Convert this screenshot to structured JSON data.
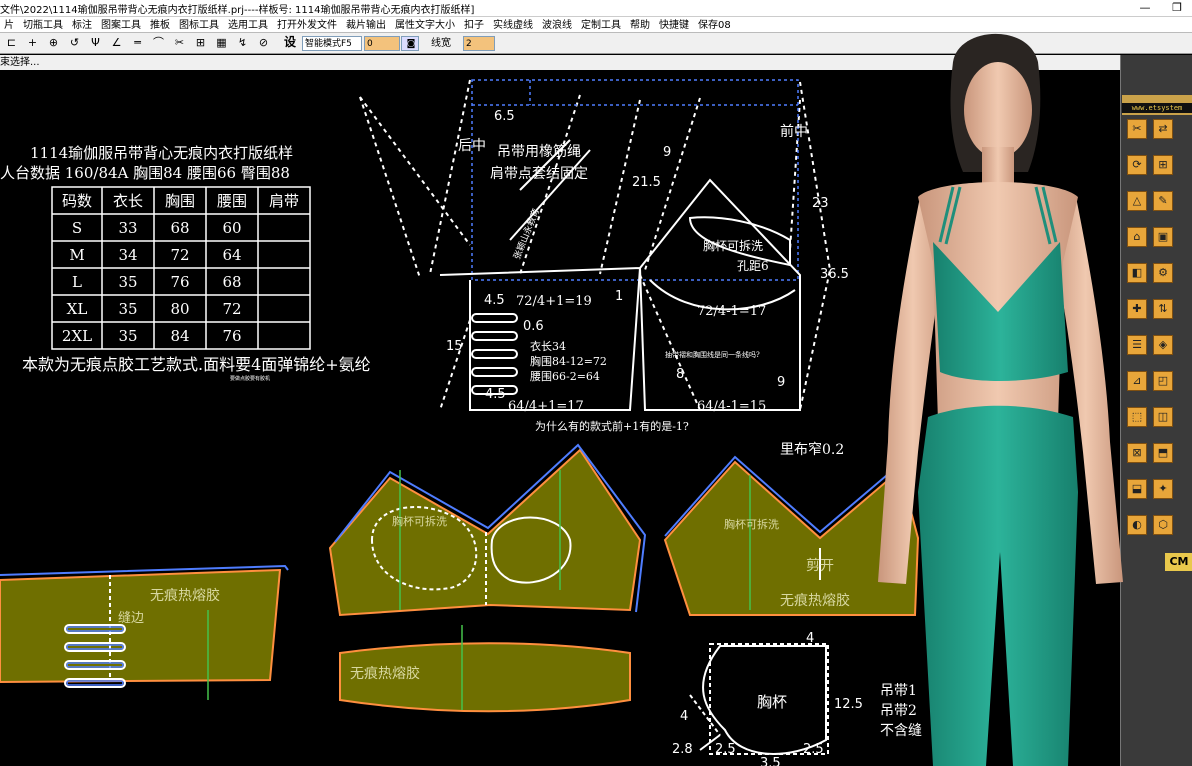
{
  "window": {
    "title": "文件\\2022\\1114瑜伽服吊带背心无痕内衣打版纸样.prj----样板号: 1114瑜伽服吊带背心无痕内衣打版纸样]",
    "restore_glyph": "❐"
  },
  "menubar": {
    "items": [
      "片",
      "切瓶工具",
      "标注",
      "图案工具",
      "推板",
      "图标工具",
      "选用工具",
      "打开外发文件",
      "裁片输出",
      "属性文字大小",
      "扣子",
      "实线虚线",
      "波浪线",
      "定制工具",
      "帮助",
      "快捷键",
      "保存08"
    ]
  },
  "toolbar": {
    "icons": [
      "⊏",
      "+",
      "⊕",
      "↺",
      "Ψ",
      "∠",
      "═",
      "⌒",
      "✂",
      "⊞",
      "▦",
      "↯",
      "⊘"
    ],
    "set_label": "设",
    "mode_select": "智能模式F5",
    "value_field": "0",
    "line_width_label": "线宽",
    "line_width_value": "2"
  },
  "status": {
    "text": "束选择..."
  },
  "right_panel": {
    "url": "www.etsystem",
    "brand": "CM"
  },
  "drawing": {
    "table_title": "1114瑜伽服吊带背心无痕内衣打版纸样",
    "body_data": "人台数据 160/84A  胸围84  腰围66  臀围88",
    "table_headers": [
      "码数",
      "衣长",
      "胸围",
      "腰围",
      "肩带"
    ],
    "table_rows": [
      [
        "S",
        "33",
        "68",
        "60",
        ""
      ],
      [
        "M",
        "34",
        "72",
        "64",
        ""
      ],
      [
        "L",
        "35",
        "76",
        "68",
        ""
      ],
      [
        "XL",
        "35",
        "80",
        "72",
        ""
      ],
      [
        "2XL",
        "35",
        "84",
        "76",
        ""
      ]
    ],
    "note_main": "本款为无痕点胶工艺款式.面料要4面弹锦纶+氨纶",
    "note_tiny": "要做点胶要有胶机",
    "back_center": "后中",
    "strap_note1": "吊带用橡筋绳",
    "strap_note2": "肩带点套结固定",
    "front_center": "前中",
    "cup_remove": "胸杯可拆洗",
    "hole_distance": "孔距6",
    "slant_text": "张颖山永教育",
    "spec_length": "衣长34",
    "spec_bust": "胸围84-12=72",
    "spec_waist": "腰围66-2=64",
    "formula_back_top": "72/4+1=19",
    "formula_front_top": "72/4-1=17",
    "formula_back_bottom": "64/4+1=17",
    "formula_front_bottom": "64/4-1=15",
    "question_small": "抽带褶和胸围线是同一条线吗?",
    "question_bottom": "为什么有的款式前+1有的是-1?",
    "lining_note": "里布窄0.2",
    "seamless_glue": "无痕热熔胶",
    "cup_opening": "胸杯可拆洗",
    "cut_open": "剪开",
    "cup_label": "胸杯",
    "strap_note_a": "吊带1",
    "strap_note_b": "吊带2",
    "strap_note_c": "不含缝",
    "binding": "缝边",
    "dims": {
      "d65": "6.5",
      "d9": "9",
      "d215": "21.5",
      "d23": "23",
      "d365": "36.5",
      "d45a": "4.5",
      "d06": "0.6",
      "d15": "15",
      "d45b": "4.5",
      "d1": "1",
      "d8": "8",
      "d9b": "9",
      "d4a": "4",
      "d4b": "4",
      "d125": "12.5",
      "d28": "2.8",
      "d25a": "2.5",
      "d25b": "2.5",
      "d35": "3.5",
      "d02": "0.2"
    }
  },
  "colors": {
    "canvas_bg": "#000000",
    "piece_fill": "#6f6f00",
    "line_white": "#ffffff",
    "line_blue": "#4f7dff",
    "line_green": "#45c24a",
    "panel_orange": "#e8a63a",
    "avatar_top": "#2aa58f"
  }
}
